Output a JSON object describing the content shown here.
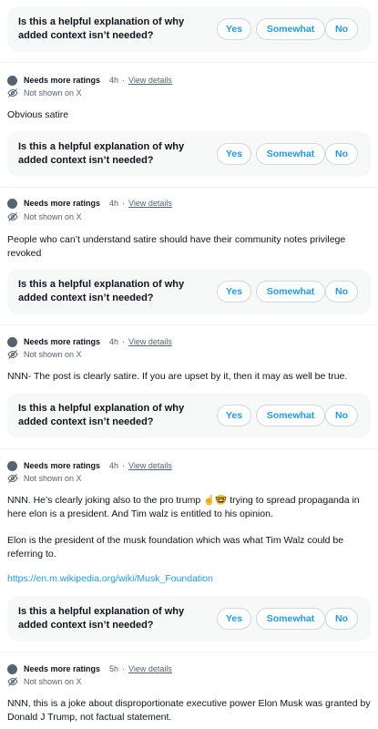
{
  "rating_prompt": {
    "question": "Is this a helpful explanation of why added context isn’t needed?",
    "yes_label": "Yes",
    "somewhat_label": "Somewhat",
    "no_label": "No"
  },
  "notes": [
    {
      "status": "Needs more ratings",
      "time": "4h",
      "separator": "·",
      "view_details": "View details",
      "visibility": "Not shown on X",
      "text": "Obvious satire"
    },
    {
      "status": "Needs more ratings",
      "time": "4h",
      "separator": "·",
      "view_details": "View details",
      "visibility": "Not shown on X",
      "text": "People who can’t understand satire should have their community notes privilege revoked"
    },
    {
      "status": "Needs more ratings",
      "time": "4h",
      "separator": "·",
      "view_details": "View details",
      "visibility": "Not shown on X",
      "text": "NNN- The post is clearly satire. If you are upset by it, then it may as well be true."
    },
    {
      "status": "Needs more ratings",
      "time": "4h",
      "separator": "·",
      "view_details": "View details",
      "visibility": "Not shown on X",
      "text_line1": "NNN. He’s clearly joking also to the pro trump ☝️🤓 trying to spread propaganda in here elon is a president. And Tim walz is entitled to his opinion.",
      "text_line2": "Elon is the president of the musk foundation which was what Tim Walz could be referring to.",
      "link": "https://en.m.wikipedia.org/wiki/Musk_Foundation"
    },
    {
      "status": "Needs more ratings",
      "time": "5h",
      "separator": "·",
      "view_details": "View details",
      "visibility": "Not shown on X",
      "text": "NNN, this is a joke about disproportionate executive power Elon Musk was granted by Donald J Trump, not factual statement."
    }
  ],
  "colors": {
    "accent": "#1d9bf0",
    "text": "#0f1419",
    "muted": "#536471",
    "card": "#f7f9f9",
    "border": "#cfd9de"
  },
  "icons": {
    "status_dot": "status-dot-icon",
    "visibility": "eye-off-icon"
  }
}
